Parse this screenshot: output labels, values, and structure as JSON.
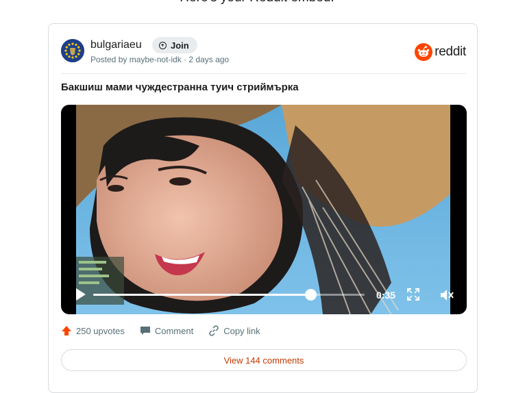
{
  "page": {
    "heading": "Here's your Reddit embed."
  },
  "post": {
    "community": "bulgariaeu",
    "join_label": "Join",
    "posted_by": "Posted by maybe-not-idk · 2 days ago",
    "title": "Бакшиш мами чуждестранна туич стриймърка",
    "brand": "reddit"
  },
  "video": {
    "time": "0:35",
    "progress": 0.8
  },
  "actions": {
    "upvotes": "250 upvotes",
    "comment": "Comment",
    "copy_link": "Copy link"
  },
  "footer": {
    "view_comments": "View 144 comments"
  },
  "colors": {
    "reddit_orange": "#ff4500",
    "upvote": "#ff4500",
    "link_red": "#c23a00"
  },
  "icons": [
    "eu-flag-icon",
    "join-plus-icon",
    "reddit-logo-icon",
    "play-icon",
    "fullscreen-icon",
    "mute-icon",
    "upvote-icon",
    "comment-icon",
    "link-icon"
  ]
}
